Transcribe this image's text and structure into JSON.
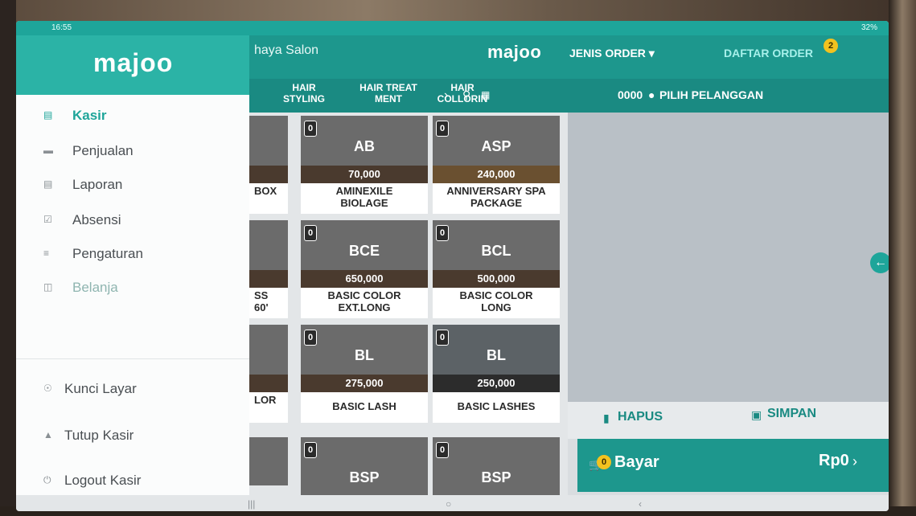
{
  "statusbar": {
    "time": "16:55",
    "battery": "32%"
  },
  "header": {
    "store_name": "haya Salon",
    "logo": "majoo",
    "jenis_order": "JENIS ORDER ▾",
    "daftar_order": "DAFTAR ORDER",
    "order_badge": "2"
  },
  "categories": [
    {
      "label": "HAIR\nSTYLING"
    },
    {
      "label": "HAIR TREAT\nMENT"
    },
    {
      "label": "HAIR\nCOLLORIN"
    }
  ],
  "customer": {
    "order_number": "0000",
    "pilih_label": "PILIH PELANGGAN"
  },
  "partial_tiles": [
    {
      "name": "BOX"
    },
    {
      "name": "SS\n 60'"
    },
    {
      "name": "LOR"
    }
  ],
  "products": [
    {
      "qty": "0",
      "code": "AB",
      "price": "70,000",
      "name": "AMINEXILE\nBIOLAGE"
    },
    {
      "qty": "0",
      "code": "ASP",
      "price": "240,000",
      "name": "ANNIVERSARY SPA\nPACKAGE"
    },
    {
      "qty": "0",
      "code": "BCE",
      "price": "650,000",
      "name": "BASIC COLOR\nEXT.LONG"
    },
    {
      "qty": "0",
      "code": "BCL",
      "price": "500,000",
      "name": "BASIC COLOR\nLONG"
    },
    {
      "qty": "0",
      "code": "BL",
      "price": "275,000",
      "name": "BASIC LASH"
    },
    {
      "qty": "0",
      "code": "BL",
      "price": "250,000",
      "name": "BASIC LASHES"
    },
    {
      "qty": "0",
      "code": "BSP",
      "price": "",
      "name": ""
    },
    {
      "qty": "0",
      "code": "BSP",
      "price": "",
      "name": ""
    }
  ],
  "cart": {
    "hapus": "HAPUS",
    "simpan": "SIMPAN",
    "bayar_badge": "0",
    "bayar": "Bayar",
    "total": "Rp0"
  },
  "drawer": {
    "logo": "majoo",
    "items": [
      {
        "label": "Kasir",
        "icon": "cashier-icon"
      },
      {
        "label": "Penjualan",
        "icon": "sales-icon"
      },
      {
        "label": "Laporan",
        "icon": "report-icon"
      },
      {
        "label": "Absensi",
        "icon": "attendance-icon"
      },
      {
        "label": "Pengaturan",
        "icon": "settings-icon"
      },
      {
        "label": "Belanja",
        "icon": "shopping-icon"
      }
    ],
    "bottom_items": [
      {
        "label": "Kunci Layar",
        "icon": "lock-icon"
      },
      {
        "label": "Tutup Kasir",
        "icon": "eject-icon"
      },
      {
        "label": "Logout Kasir",
        "icon": "power-icon"
      }
    ]
  },
  "colors": {
    "accent": "#1ea59a",
    "header": "#1d978d",
    "badge": "#f2c21f"
  }
}
